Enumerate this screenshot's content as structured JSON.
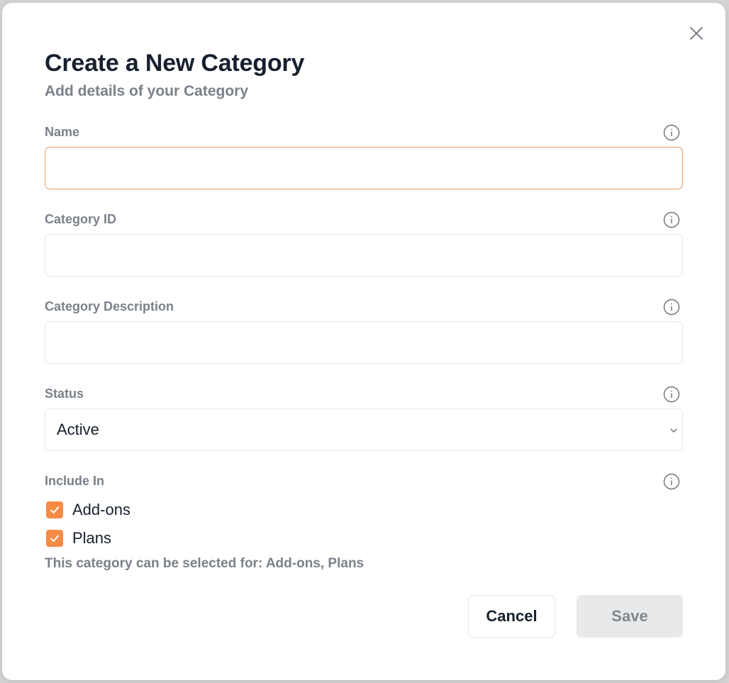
{
  "modal": {
    "title": "Create a New Category",
    "subtitle": "Add details of your Category"
  },
  "fields": {
    "name": {
      "label": "Name",
      "value": "",
      "placeholder": ""
    },
    "category_id": {
      "label": "Category ID",
      "value": "",
      "placeholder": ""
    },
    "description": {
      "label": "Category Description",
      "value": "",
      "placeholder": ""
    },
    "status": {
      "label": "Status",
      "selected": "Active"
    },
    "include_in": {
      "label": "Include In",
      "options": [
        {
          "label": "Add-ons",
          "checked": true
        },
        {
          "label": "Plans",
          "checked": true
        }
      ],
      "hint": "This category can be selected for: Add-ons, Plans"
    }
  },
  "actions": {
    "cancel_label": "Cancel",
    "save_label": "Save"
  },
  "colors": {
    "accent": "#f78a45",
    "focus_border": "#ef9a6a",
    "title": "#17202e",
    "muted": "#7a818a"
  },
  "icons": [
    "close-icon",
    "info-icon",
    "chevron-down-icon",
    "checkmark-icon"
  ]
}
